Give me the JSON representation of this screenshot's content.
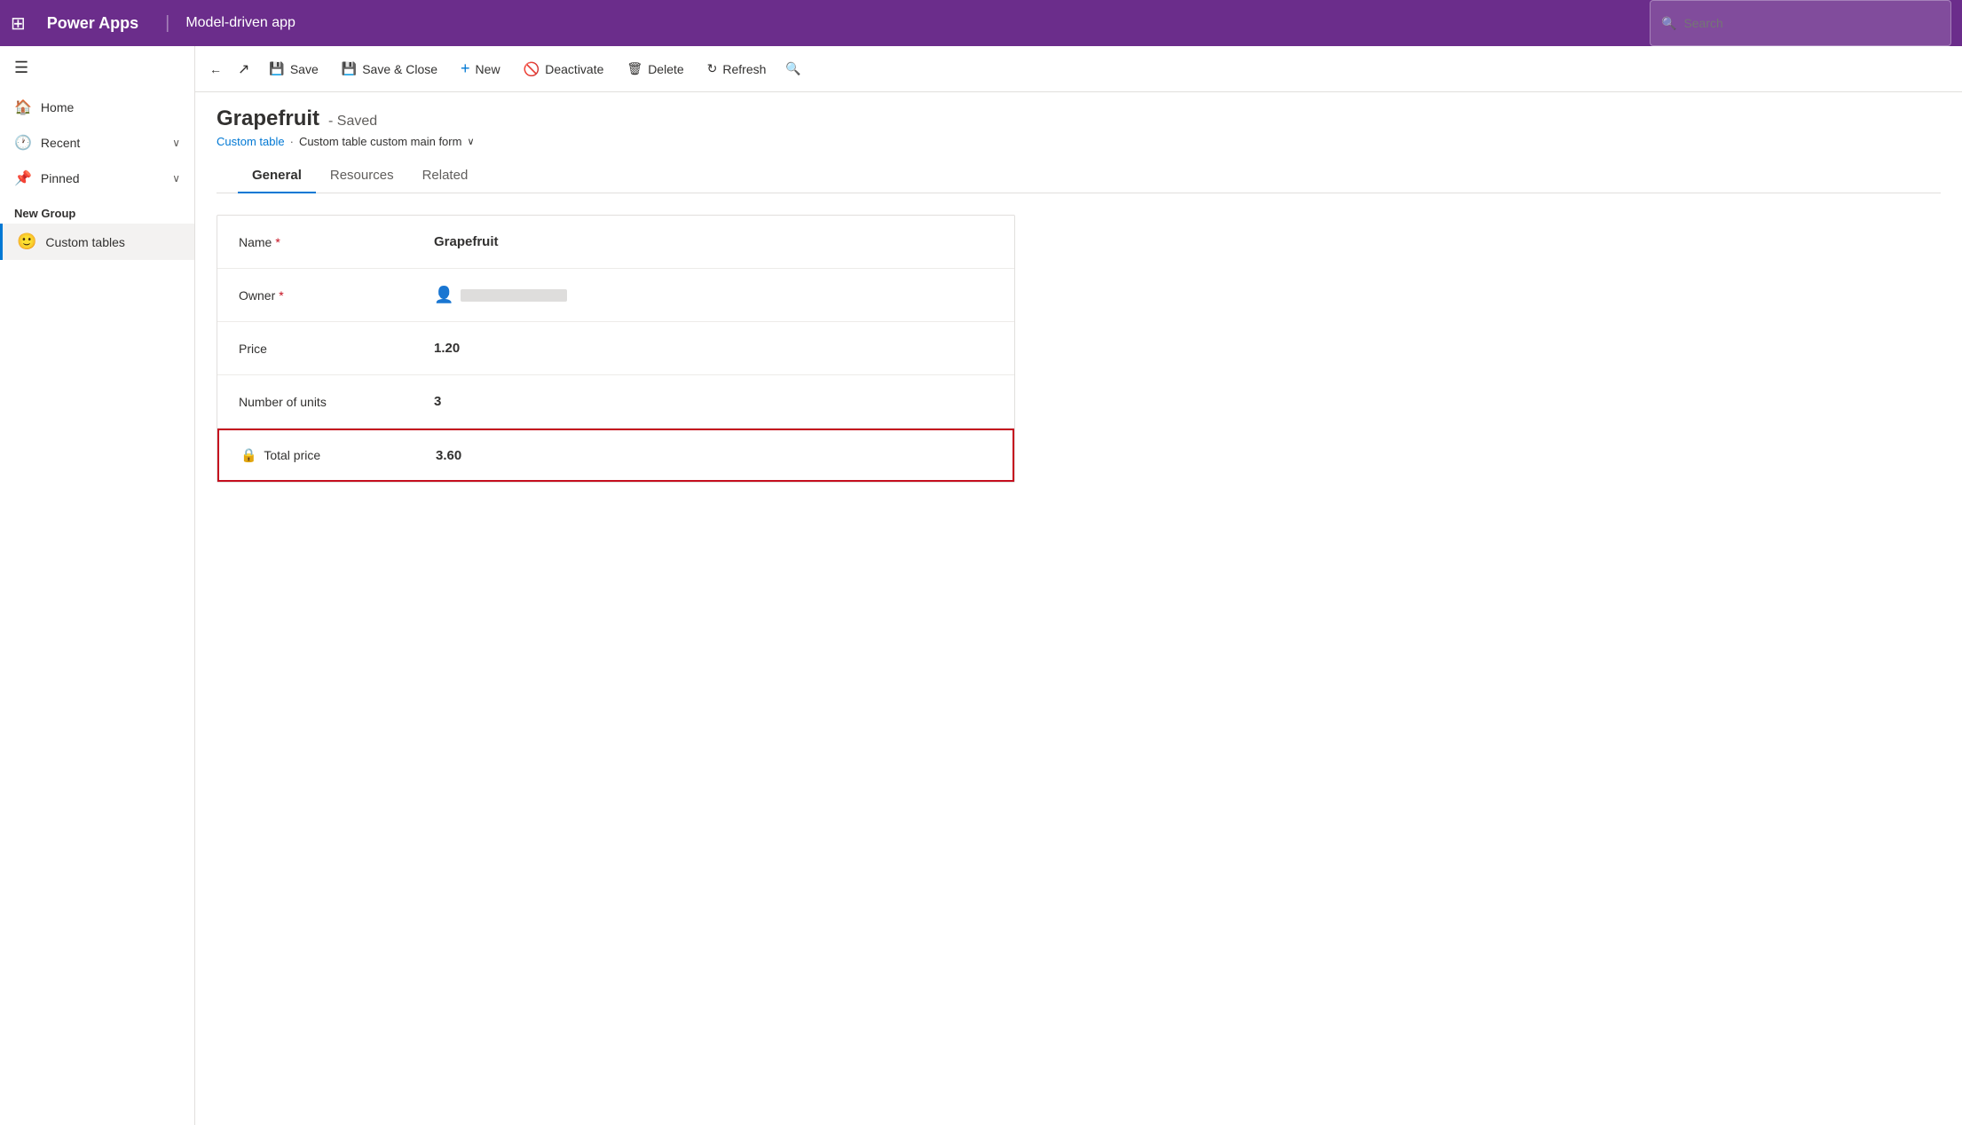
{
  "topNav": {
    "appGridIcon": "⊞",
    "appName": "Power Apps",
    "divider": "|",
    "modelName": "Model-driven app",
    "search": {
      "placeholder": "Search",
      "icon": "🔍"
    }
  },
  "sidebar": {
    "hamburgerIcon": "☰",
    "navItems": [
      {
        "id": "home",
        "icon": "🏠",
        "label": "Home",
        "hasChevron": false
      },
      {
        "id": "recent",
        "icon": "🕐",
        "label": "Recent",
        "hasChevron": true
      },
      {
        "id": "pinned",
        "icon": "📌",
        "label": "Pinned",
        "hasChevron": true
      }
    ],
    "groupLabel": "New Group",
    "customTablesItem": {
      "emoji": "🙂",
      "label": "Custom tables"
    }
  },
  "commandBar": {
    "backIcon": "←",
    "openIcon": "↗",
    "saveLabel": "Save",
    "saveIcon": "💾",
    "saveCloseLabel": "Save & Close",
    "saveCloseIcon": "💾",
    "newLabel": "New",
    "newIcon": "+",
    "deactivateLabel": "Deactivate",
    "deactivateIcon": "🚫",
    "deleteLabel": "Delete",
    "deleteIcon": "🗑",
    "refreshLabel": "Refresh",
    "refreshIcon": "↻",
    "searchIcon": "🔍"
  },
  "pageHeader": {
    "title": "Grapefruit",
    "status": "- Saved",
    "breadcrumb": {
      "tableLabel": "Custom table",
      "separator": "·",
      "formLabel": "Custom table custom main form",
      "chevron": "∨"
    }
  },
  "tabs": [
    {
      "id": "general",
      "label": "General",
      "active": true
    },
    {
      "id": "resources",
      "label": "Resources",
      "active": false
    },
    {
      "id": "related",
      "label": "Related",
      "active": false
    }
  ],
  "form": {
    "rows": [
      {
        "id": "name",
        "label": "Name",
        "required": true,
        "value": "Grapefruit",
        "type": "text"
      },
      {
        "id": "owner",
        "label": "Owner",
        "required": true,
        "value": "",
        "type": "owner"
      },
      {
        "id": "price",
        "label": "Price",
        "required": false,
        "value": "1.20",
        "type": "text"
      },
      {
        "id": "number-of-units",
        "label": "Number of units",
        "required": false,
        "value": "3",
        "type": "text"
      },
      {
        "id": "total-price",
        "label": "Total price",
        "required": false,
        "value": "3.60",
        "type": "locked",
        "highlighted": true
      }
    ]
  }
}
